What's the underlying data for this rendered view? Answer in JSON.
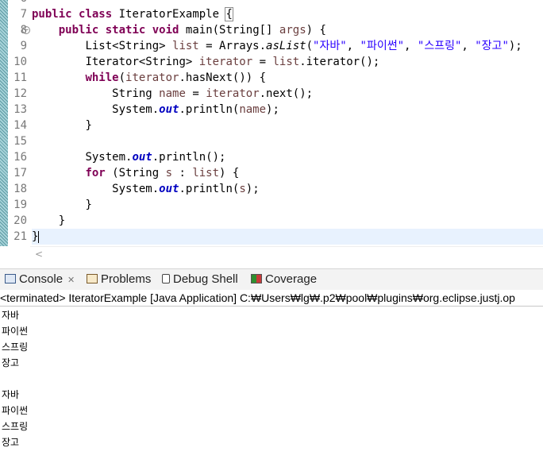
{
  "editor": {
    "line_numbers": [
      "7",
      "8",
      "9",
      "10",
      "11",
      "12",
      "13",
      "14",
      "15",
      "16",
      "17",
      "18",
      "19",
      "20",
      "21"
    ],
    "top_partial_line": "6",
    "code": {
      "l7": {
        "kw1": "public",
        "kw2": "class",
        "name": "IteratorExample",
        "brace": "{"
      },
      "l8": {
        "indent": "    ",
        "kw1": "public",
        "kw2": "static",
        "kw3": "void",
        "sig": "main(String[] ",
        "param": "args",
        "tail": ") {"
      },
      "l9": {
        "indent": "        ",
        "pre": "List<String> ",
        "var": "list",
        "mid": " = Arrays.",
        "method": "asList",
        "open": "(",
        "s1": "\"자바\"",
        "c1": ", ",
        "s2": "\"파이썬\"",
        "c2": ", ",
        "s3": "\"스프링\"",
        "c3": ", ",
        "s4": "\"장고\"",
        "close": ");"
      },
      "l10": {
        "indent": "        ",
        "pre": "Iterator<String> ",
        "var": "iterator",
        "mid": " = ",
        "var2": "list",
        "tail": ".iterator();"
      },
      "l11": {
        "indent": "        ",
        "kw": "while",
        "open": "(",
        "var": "iterator",
        "tail": ".hasNext()) {"
      },
      "l12": {
        "indent": "            ",
        "pre": "String ",
        "var": "name",
        "mid": " = ",
        "var2": "iterator",
        "tail": ".next();"
      },
      "l13": {
        "indent": "            ",
        "pre": "System.",
        "field": "out",
        "mid": ".println(",
        "var": "name",
        "tail": ");"
      },
      "l14": {
        "indent": "        ",
        "text": "}"
      },
      "l16": {
        "indent": "        ",
        "pre": "System.",
        "field": "out",
        "tail": ".println();"
      },
      "l17": {
        "indent": "        ",
        "kw": "for",
        "pre": " (String ",
        "var": "s",
        "mid": " : ",
        "var2": "list",
        "tail": ") {"
      },
      "l18": {
        "indent": "            ",
        "pre": "System.",
        "field": "out",
        "mid": ".println(",
        "var": "s",
        "tail": ");"
      },
      "l19": {
        "indent": "        ",
        "text": "}"
      },
      "l20": {
        "indent": "    ",
        "text": "}"
      },
      "l21": {
        "text": "}"
      }
    },
    "scroll_left_glyph": "<"
  },
  "views": {
    "tabs": [
      {
        "label": "Console",
        "close": "✕"
      },
      {
        "label": "Problems"
      },
      {
        "label": "Debug Shell"
      },
      {
        "label": "Coverage"
      }
    ]
  },
  "console": {
    "header": "<terminated> IteratorExample [Java Application] C:₩Users₩lg₩.p2₩pool₩plugins₩org.eclipse.justj.op",
    "output": [
      "자바",
      "파이썬",
      "스프링",
      "장고",
      "",
      "자바",
      "파이썬",
      "스프링",
      "장고"
    ]
  },
  "colors": {
    "keyword": "#7f0055",
    "string": "#2a00ff",
    "field": "#0000c0",
    "local_var": "#6a3e3e",
    "current_line": "#e8f2fe"
  }
}
